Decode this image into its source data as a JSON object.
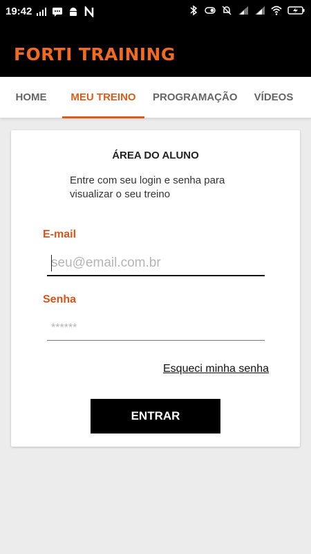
{
  "status_bar": {
    "time": "19:42",
    "left_icons": [
      "signal-bars-icon",
      "chat-icon",
      "android-icon",
      "n-icon"
    ],
    "right_icons": [
      "bluetooth-icon",
      "toggle-icon",
      "bell-off-icon",
      "signal-icon",
      "signal-icon",
      "wifi-icon",
      "battery-charging-icon"
    ]
  },
  "app": {
    "brand": "FORTI TRAINING",
    "accent": "#e05a1a"
  },
  "tabs": [
    {
      "label": "HOME",
      "active": false
    },
    {
      "label": "MEU TREINO",
      "active": true
    },
    {
      "label": "PROGRAMAÇÃO",
      "active": false
    },
    {
      "label": "VÍDEOS",
      "active": false
    }
  ],
  "login": {
    "title": "ÁREA DO ALUNO",
    "description": "Entre com seu login e senha para visualizar o seu treino",
    "email_label": "E-mail",
    "email_placeholder": "seu@email.com.br",
    "email_value": "",
    "password_label": "Senha",
    "password_placeholder": "******",
    "password_value": "",
    "forgot_link": "Esqueci minha senha",
    "submit": "ENTRAR"
  }
}
